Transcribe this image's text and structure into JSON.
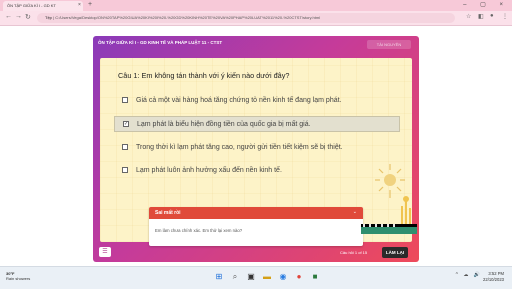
{
  "browser": {
    "tab_title": "ÔN TẬP GIỮA KÌ I - GD KT",
    "tab_close": "×",
    "new_tab": "+",
    "window_controls": "– ▢ ×",
    "nav_back": "←",
    "nav_forward": "→",
    "nav_reload": "↻",
    "address_prefix": "Tệp",
    "address_url": "C:/Users/Vega/Desktop/ON%20TAP%20GIUA%20KI%20I%20-%20GD%20KINH%20TE%20VA%20PHAP%20LUAT%2011%20-%20CTST/story.html"
  },
  "quiz": {
    "title": "ÔN TẬP GIỮA KÌ I - GD KINH TẾ VÀ PHÁP LUẬT 11 - CTST",
    "top_button": "TÀI NGUYÊN",
    "question": "Câu 1: Em không tán thành với ý kiến nào dưới đây?",
    "options": [
      {
        "text": "Giá cả một vài hàng hoá tăng chứng tỏ nền kinh tế đang lạm phát.",
        "checked": false
      },
      {
        "text": "Lạm phát là biểu hiện đồng tiền của quốc gia bị mất giá.",
        "checked": true
      },
      {
        "text": "Trong thời kì lạm phát tăng cao, người gửi tiền tiết kiệm sẽ bị thiệt.",
        "checked": false
      },
      {
        "text": "Lạm phát luôn ảnh hưởng xấu đến nền kinh tế.",
        "checked": false
      }
    ],
    "checkmark": "✓",
    "feedback": {
      "title": "Sai mất rồi",
      "chevron": "⌄",
      "body": "Em làm chưa chính xác. Em thử lại xem nào?"
    },
    "menu_icon": "☰",
    "counter": "Câu hỏi 1 of 15",
    "retry_button": "LÀM LẠI"
  },
  "taskbar": {
    "temperature": "30°F",
    "weather_text": "Rain showers",
    "tray": "^ ☁ 🔊",
    "time": "3:52 PM",
    "date": "22/10/2023"
  },
  "colors": {
    "feedback_red": "#e04a3a",
    "retry_dark": "#2a2a2a",
    "paper": "#fdf3c8"
  }
}
